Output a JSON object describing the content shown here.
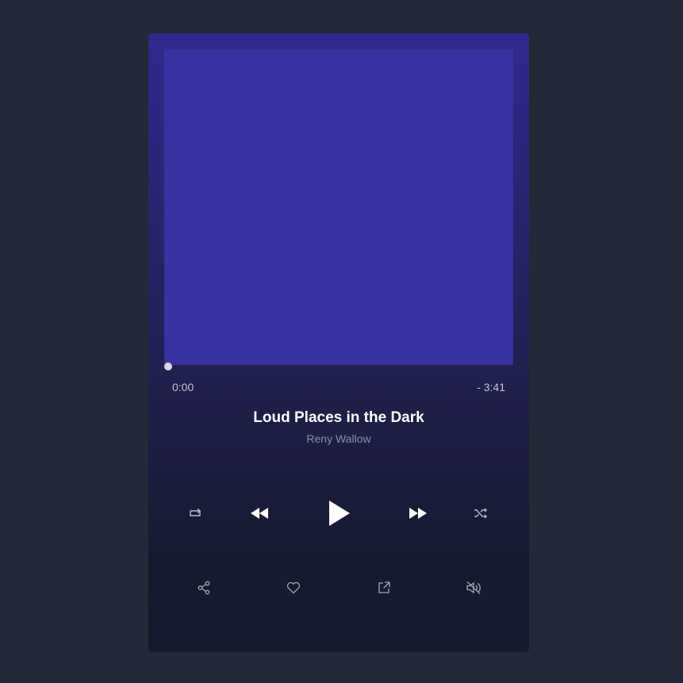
{
  "track": {
    "title": "Loud Places in the Dark",
    "artist": "Reny Wallow",
    "time_elapsed": "0:00",
    "time_remaining": "- 3:41",
    "progress_fraction": 0
  },
  "controls": {
    "primary": [
      "repeat-icon",
      "rewind-icon",
      "play-icon",
      "fast-forward-icon",
      "shuffle-icon"
    ],
    "secondary": [
      "share-icon",
      "heart-icon",
      "external-link-icon",
      "volume-mute-icon"
    ]
  },
  "colors": {
    "page_background": "#222937",
    "cover_placeholder": "#3831a2",
    "title_text": "#ffffff",
    "artist_text": "#8b8ea6",
    "icon": "#ffffff",
    "secondary_icon": "#a6a8bb"
  }
}
